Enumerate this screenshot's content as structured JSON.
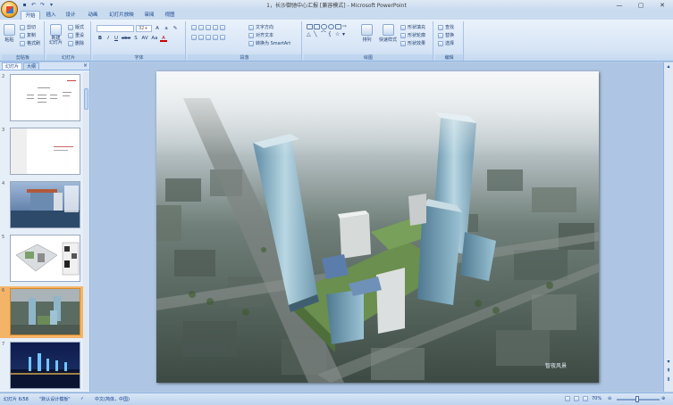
{
  "window": {
    "title": "1，长沙御驰中心汇报 [兼容模式] - Microsoft PowerPoint",
    "controls": [
      "—",
      "▢",
      "✕"
    ]
  },
  "qat": [
    "save-icon",
    "undo-icon",
    "redo-icon",
    "dropdown-icon"
  ],
  "tabs": [
    "开始",
    "插入",
    "设计",
    "动画",
    "幻灯片放映",
    "审阅",
    "视图"
  ],
  "ribbon": {
    "clipboard": {
      "label": "剪贴板",
      "paste": "粘贴",
      "cut": "剪切",
      "copy": "复制",
      "painter": "格式刷"
    },
    "slides": {
      "label": "幻灯片",
      "new_slide": "新建\n幻灯片",
      "layout": "版式",
      "reset": "重设",
      "delete": "删除"
    },
    "font": {
      "label": "字体",
      "font_name": "",
      "font_size": "32+",
      "buttons": [
        "B",
        "I",
        "U",
        "abe",
        "S",
        "AV",
        "Aa",
        "A"
      ]
    },
    "paragraph": {
      "label": "段落",
      "text_direction": "文字方向",
      "align_text": "对齐文本",
      "smartart": "转换为 SmartArt"
    },
    "drawing": {
      "label": "绘图",
      "arrange": "排列",
      "quick_styles": "快速样式",
      "shape_fill": "形状填充",
      "shape_outline": "形状轮廓",
      "shape_effects": "形状效果"
    },
    "editing": {
      "label": "编辑",
      "find": "查找",
      "replace": "替换",
      "select": "选择"
    }
  },
  "pane": {
    "tabs": [
      "幻灯片",
      "大纲"
    ],
    "close": "×"
  },
  "thumbnails": [
    {
      "num": "2"
    },
    {
      "num": "3"
    },
    {
      "num": "4"
    },
    {
      "num": "5"
    },
    {
      "num": "6"
    },
    {
      "num": "7"
    }
  ],
  "selected_slide": "6",
  "slide": {
    "watermark": "智夜风景"
  },
  "status": {
    "slide_info": "幻灯片 6/58",
    "theme": "\"默认设计模板\"",
    "language": "中文(简体，中国)",
    "zoom": "70%"
  },
  "colors": {
    "ribbon_bg": "#dfeaf7",
    "accent": "#15428b",
    "selected_thumb": "#f4b468",
    "workspace": "#aec6e3"
  }
}
